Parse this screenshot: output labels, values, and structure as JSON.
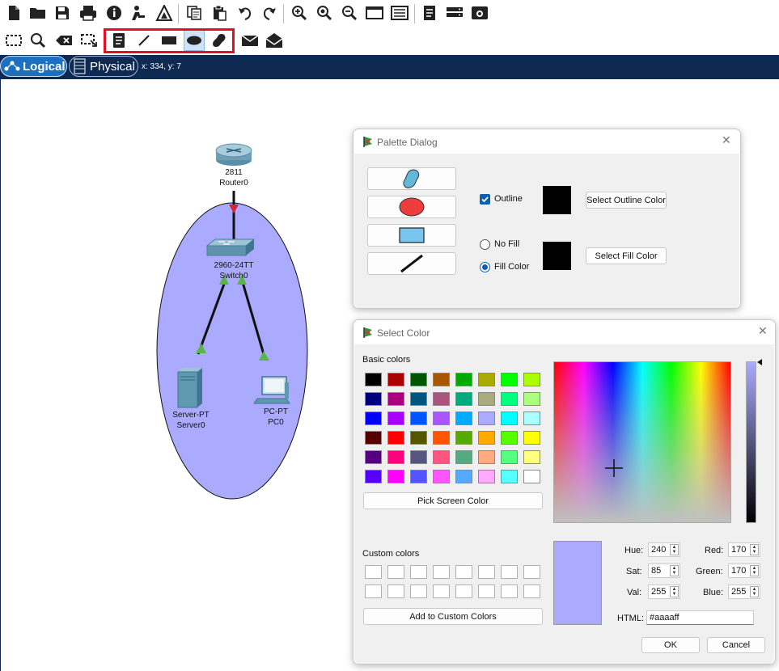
{
  "toolbar_main": {
    "items": [
      "new-file-icon",
      "open-folder-icon",
      "save-icon",
      "save-as-icon",
      "print-icon",
      "info-icon",
      "activity-wizard-icon",
      "pdu-tool-icon",
      "copy-icon",
      "paste-icon",
      "undo-icon",
      "redo-icon",
      "zoom-in-icon",
      "zoom-reset-icon",
      "zoom-out-icon",
      "drawing-palette-icon",
      "custom-device-icon",
      "notes-icon",
      "cluster-icon",
      "screenshot-icon"
    ]
  },
  "toolbar_tools": {
    "items": [
      "select-icon",
      "inspect-icon",
      "delete-icon",
      "resize-shape-icon"
    ],
    "drawing_items": [
      "place-note-icon",
      "draw-line-icon",
      "draw-rectangle-icon",
      "draw-ellipse-icon",
      "draw-freeform-icon"
    ],
    "extra_items": [
      "add-simple-pdu-icon",
      "add-complex-pdu-icon"
    ],
    "active_tool": "draw-ellipse-icon"
  },
  "navbar": {
    "logical_label": "Logical",
    "physical_label": "Physical",
    "coords": "x: 334, y: 7"
  },
  "topology": {
    "ellipse_fill": "#aaaaff",
    "router": {
      "model": "2811",
      "name": "Router0"
    },
    "switch": {
      "model": "2960-24TT",
      "name": "Switch0"
    },
    "server": {
      "model": "Server-PT",
      "name": "Server0"
    },
    "pc": {
      "model": "PC-PT",
      "name": "PC0"
    },
    "link_up_color": "#d9223a",
    "link_ok_color": "#5bb545"
  },
  "palette_dialog": {
    "title": "Palette Dialog",
    "shapes": [
      "freeform-shape-button",
      "ellipse-shape-button",
      "rectangle-shape-button",
      "line-shape-button"
    ],
    "outline_label": "Outline",
    "outline_checked": true,
    "outline_color": "#000000",
    "select_outline_label": "Select Outline Color",
    "no_fill_label": "No Fill",
    "fill_color_label": "Fill Color",
    "fill_selected": "fill_color",
    "fill_color": "#000000",
    "select_fill_label": "Select Fill Color"
  },
  "select_color": {
    "title": "Select Color",
    "basic_colors_label": "Basic colors",
    "basic_colors": [
      [
        "#000000",
        "#aa0000",
        "#005500",
        "#aa5500",
        "#00aa00",
        "#aaaa00",
        "#00ff00",
        "#aaff00"
      ],
      [
        "#00007f",
        "#aa007f",
        "#00557f",
        "#aa557f",
        "#00aa7f",
        "#aaaa7f",
        "#00ff7f",
        "#aaff7f"
      ],
      [
        "#0000ff",
        "#aa00ff",
        "#0055ff",
        "#aa55ff",
        "#00aaff",
        "#aaaaff",
        "#00ffff",
        "#aaffff"
      ],
      [
        "#550000",
        "#ff0000",
        "#555500",
        "#ff5500",
        "#55aa00",
        "#ffaa00",
        "#55ff00",
        "#ffff00"
      ],
      [
        "#55007f",
        "#ff007f",
        "#55557f",
        "#ff557f",
        "#55aa7f",
        "#ffaa7f",
        "#55ff7f",
        "#ffff7f"
      ],
      [
        "#5500ff",
        "#ff00ff",
        "#5555ff",
        "#ff55ff",
        "#55aaff",
        "#ffaaff",
        "#55ffff",
        "#ffffff"
      ]
    ],
    "pick_screen_label": "Pick Screen Color",
    "custom_colors_label": "Custom colors",
    "add_custom_label": "Add to Custom Colors",
    "current_color": "#aaaaff",
    "hue_label": "Hue:",
    "hue": "240",
    "sat_label": "Sat:",
    "sat": "85",
    "val_label": "Val:",
    "val": "255",
    "red_label": "Red:",
    "red": "170",
    "green_label": "Green:",
    "green": "170",
    "blue_label": "Blue:",
    "blue": "255",
    "html_label": "HTML:",
    "html": "#aaaaff",
    "ok_label": "OK",
    "cancel_label": "Cancel"
  }
}
